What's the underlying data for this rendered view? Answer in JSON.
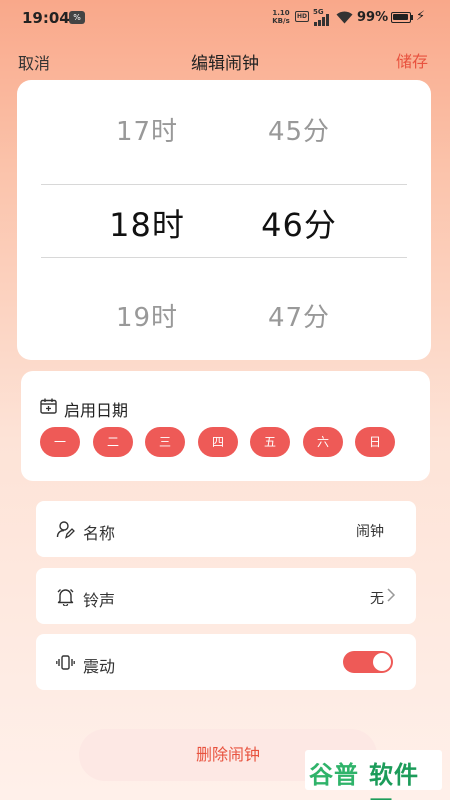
{
  "status_bar": {
    "time": "19:04",
    "badge": "%",
    "speed_value": "1.10",
    "speed_unit": "KB/s",
    "hd": "HD",
    "network": "5G",
    "battery": "99%",
    "charging": "⚡"
  },
  "nav": {
    "cancel_label": "取消",
    "title": "编辑闹钟",
    "save_label": "储存"
  },
  "time_picker": {
    "rows": [
      {
        "hour": "17时",
        "minute": "45分"
      },
      {
        "hour": "18时",
        "minute": "46分"
      },
      {
        "hour": "19时",
        "minute": "47分"
      }
    ],
    "selected_index": 1
  },
  "repeat_days": {
    "label": "启用日期",
    "icon": "calendar-icon",
    "days": [
      "一",
      "二",
      "三",
      "四",
      "五",
      "六",
      "日"
    ],
    "active_color": "#ee5a57"
  },
  "settings": {
    "name": {
      "label": "名称",
      "value": "闹钟",
      "icon": "user-edit-icon"
    },
    "ringtone": {
      "label": "铃声",
      "value": "无",
      "icon": "bell-icon"
    },
    "vibrate": {
      "label": "震动",
      "enabled": true,
      "icon": "vibrate-icon"
    }
  },
  "delete_label": "删除闹钟",
  "watermark": {
    "text_left": "谷普",
    "text_right": "软件园"
  },
  "colors": {
    "accent": "#e8533f",
    "toggle_on": "#ee5a57",
    "delete_bg": "#fde8e4"
  }
}
